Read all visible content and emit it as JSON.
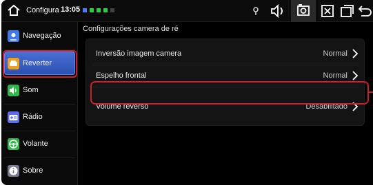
{
  "statusbar": {
    "app_name": "Configura",
    "time": "13:05",
    "notification_colors": [
      "#4a7bff",
      "#2ecc40",
      "#2ecc40",
      "#2ecc40",
      "#555555"
    ]
  },
  "sidebar": {
    "items": [
      {
        "label": "Navegação",
        "icon": "navigation-icon",
        "color": "#3f7bea"
      },
      {
        "label": "Reverter",
        "icon": "car-icon",
        "color": "#f0a020",
        "active": true
      },
      {
        "label": "Som",
        "icon": "speaker-icon",
        "color": "#2fb84a"
      },
      {
        "label": "Rádio",
        "icon": "radio-icon",
        "color": "#5b6df0"
      },
      {
        "label": "Volante",
        "icon": "steering-wheel-icon",
        "color": "#2fb84a"
      },
      {
        "label": "Sobre",
        "icon": "info-icon",
        "color": "#7a7a92"
      }
    ]
  },
  "main": {
    "title": "Configurações camera de ré",
    "rows": [
      {
        "label": "Inversão imagem camera",
        "value": "Normal"
      },
      {
        "label": "Espelho frontal",
        "value": "Normal"
      },
      {
        "label": "Volume reverso",
        "value": "Desabilitado"
      }
    ]
  },
  "colors": {
    "highlight": "#c9202a",
    "active_item": "#3a5fc8"
  }
}
